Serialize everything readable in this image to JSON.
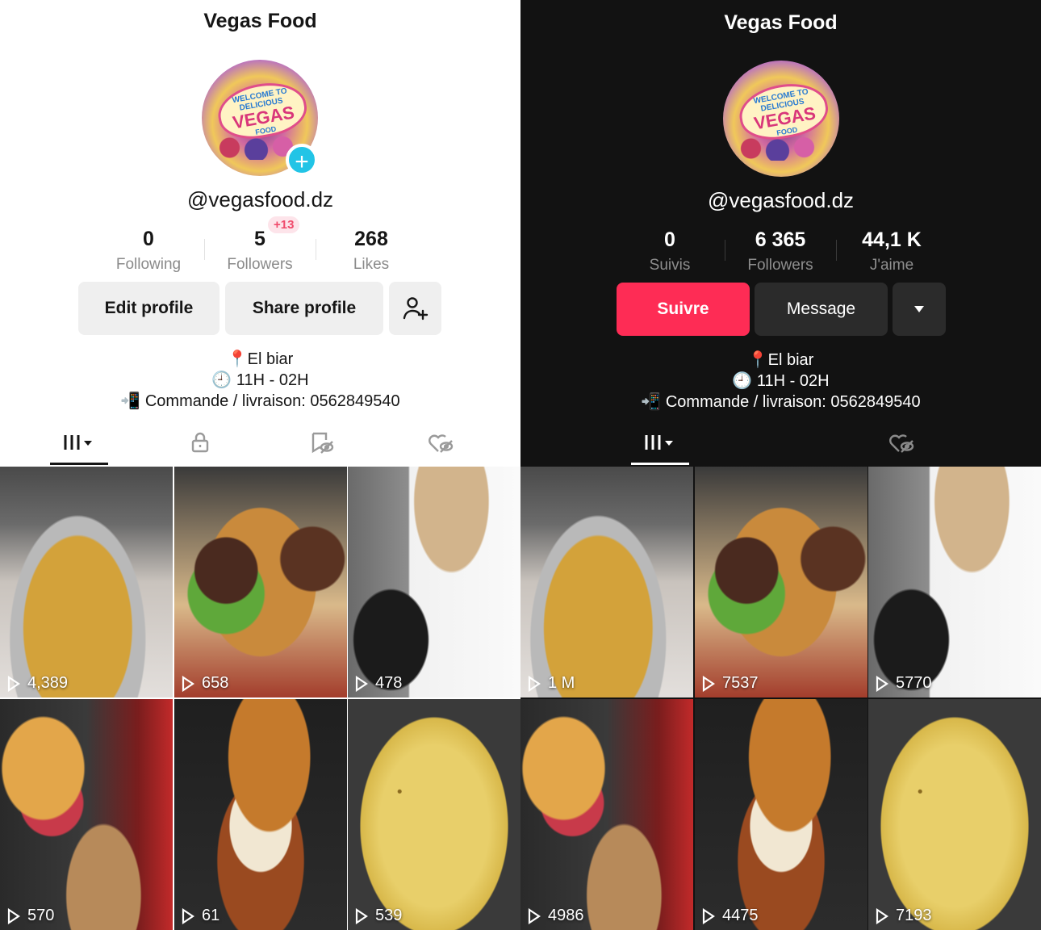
{
  "left": {
    "title": "Vegas Food",
    "avatar": {
      "line1": "WELCOME TO DELICIOUS",
      "line2": "VEGAS",
      "line3": "FOOD"
    },
    "handle": "@vegasfood.dz",
    "stats": [
      {
        "value": "0",
        "label": "Following"
      },
      {
        "value": "5",
        "label": "Followers"
      },
      {
        "value": "268",
        "label": "Likes"
      }
    ],
    "new_followers_badge": "+13",
    "buttons": {
      "edit": "Edit profile",
      "share": "Share profile"
    },
    "bio": [
      "📍El biar",
      "🕘 11H - 02H",
      "📲 Commande / livraison: 0562849540"
    ],
    "videos": [
      "4,389",
      "658",
      "478",
      "570",
      "61",
      "539"
    ]
  },
  "right": {
    "title": "Vegas Food",
    "avatar": {
      "line1": "WELCOME TO DELICIOUS",
      "line2": "VEGAS",
      "line3": "FOOD"
    },
    "handle": "@vegasfood.dz",
    "stats": [
      {
        "value": "0",
        "label": "Suivis"
      },
      {
        "value": "6 365",
        "label": "Followers"
      },
      {
        "value": "44,1 K",
        "label": "J'aime"
      }
    ],
    "buttons": {
      "follow": "Suivre",
      "message": "Message"
    },
    "bio": [
      "📍El biar",
      "🕘 11H - 02H",
      "📲 Commande / livraison: 0562849540"
    ],
    "videos": [
      "1 M",
      "7537",
      "5770",
      "4986",
      "4475",
      "7193"
    ]
  },
  "colors": {
    "follow_red": "#fe2c55",
    "plus_cyan": "#22c4e6"
  }
}
